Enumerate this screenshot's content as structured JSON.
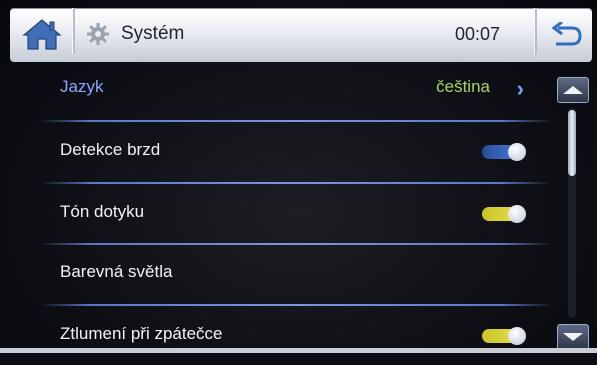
{
  "header": {
    "title": "Systém",
    "time": "00:07",
    "icons": {
      "home": "home-icon",
      "settings": "gear-icon",
      "back": "back-arrow-icon"
    }
  },
  "settings": {
    "language": {
      "label": "Jazyk",
      "value": "čeština",
      "chevron": "›"
    },
    "brake_detection": {
      "label": "Detekce brzd",
      "state": "on",
      "color": "#4a7bdc"
    },
    "touch_tone": {
      "label": "Tón dotyku",
      "state": "on",
      "color": "#e6e24a"
    },
    "color_lights": {
      "label": "Barevná světla"
    },
    "reverse_mute": {
      "label": "Ztlumení při zpátečce",
      "state": "on",
      "color": "#e6e24a"
    }
  },
  "scrollbar": {
    "position_fraction": 0.0,
    "visible_fraction": 0.3
  }
}
